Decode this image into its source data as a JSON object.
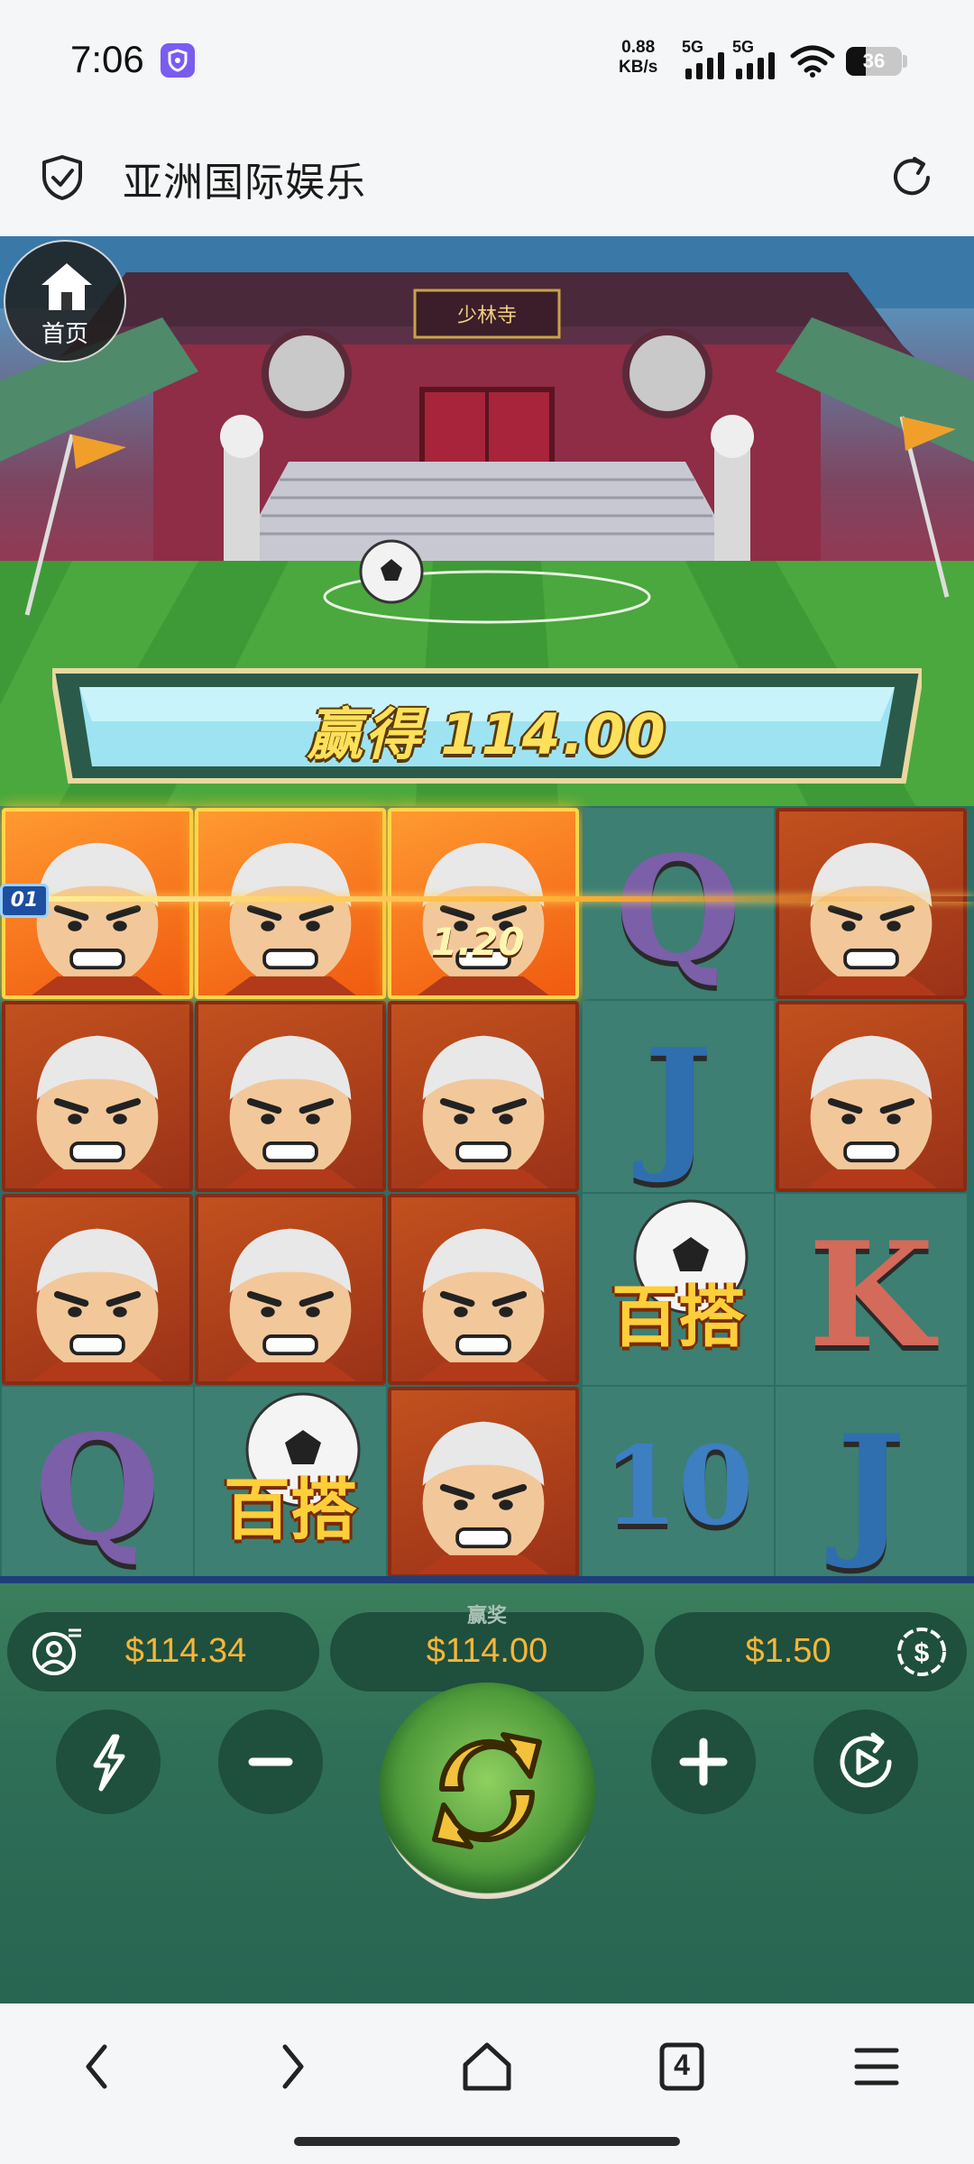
{
  "status_bar": {
    "time": "7:06",
    "net_speed_value": "0.88",
    "net_speed_unit": "KB/s",
    "sim1": "5G",
    "sim2": "5G",
    "battery": "36",
    "battery_level": 0.36
  },
  "browser": {
    "site_title": "亚洲国际娱乐",
    "tab_count": "4"
  },
  "game": {
    "home_label": "首页",
    "temple_sign": "少林寺",
    "win_label": "赢得",
    "win_amount": "114.00",
    "payline_badge": "01",
    "multiplier": "1.20",
    "wild_label": "百搭",
    "reels": [
      [
        "monk-win",
        "monk",
        "monk",
        "Q"
      ],
      [
        "monk-win",
        "monk",
        "monk",
        "wild"
      ],
      [
        "monk-win",
        "monk",
        "monk",
        "monk"
      ],
      [
        "Q",
        "J",
        "wild",
        "10"
      ],
      [
        "monk",
        "monk",
        "K",
        "J"
      ]
    ],
    "balance": "$114.34",
    "win_caption": "赢奖",
    "win_value": "$114.00",
    "bet": "$1.50",
    "colors": {
      "gold": "#f5b63a",
      "pill": "#1f4f3d",
      "win_glow": "#ffbf2a"
    },
    "icons": [
      "profile-icon",
      "dollar-icon",
      "lightning-icon",
      "minus-icon",
      "spin-icon",
      "plus-icon",
      "autoplay-icon"
    ]
  }
}
